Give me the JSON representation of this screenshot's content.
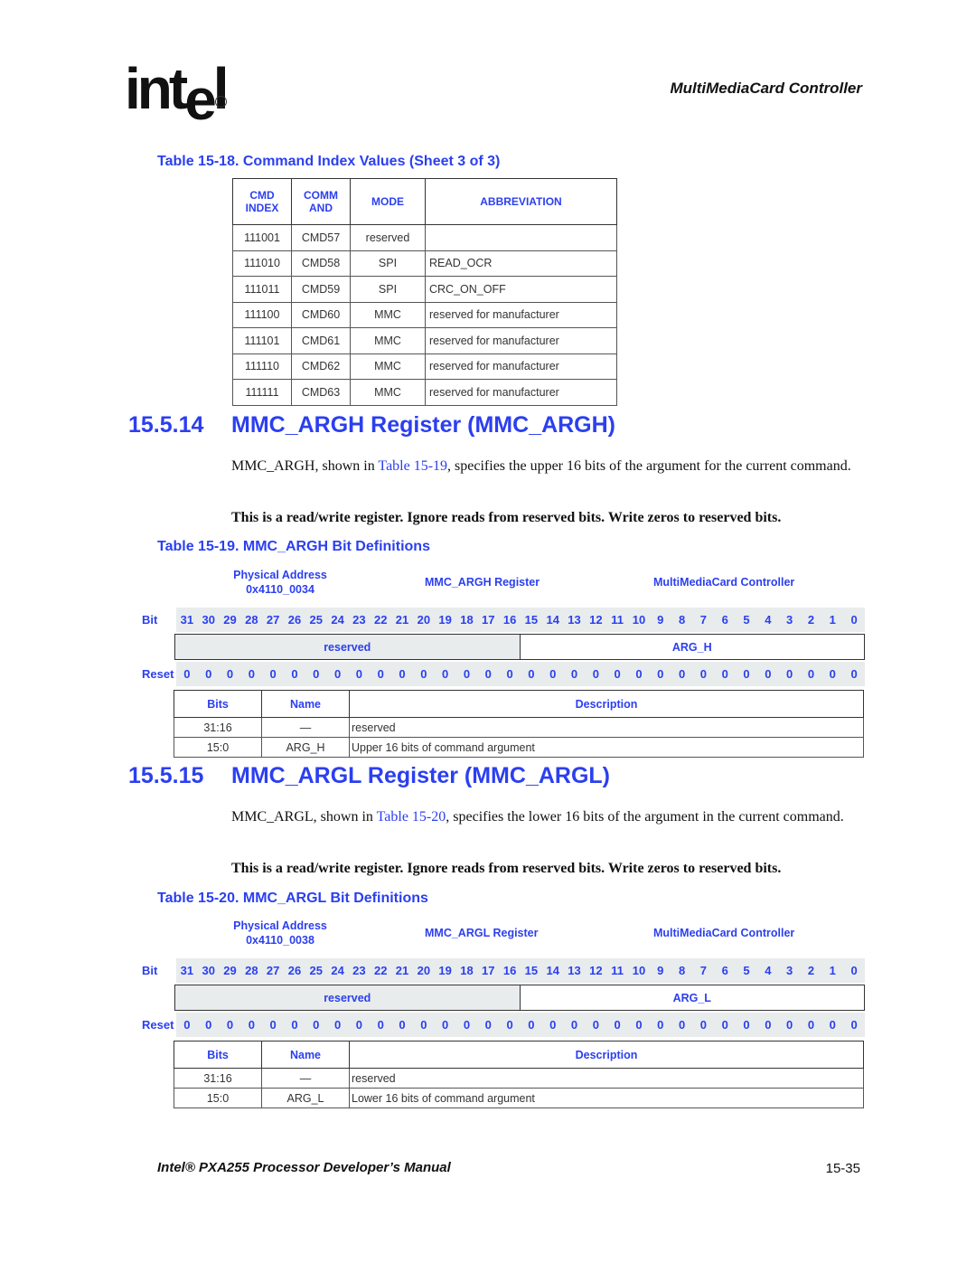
{
  "header": {
    "logo": "intel",
    "chapter": "MultiMediaCard Controller"
  },
  "table18": {
    "caption": "Table 15-18. Command Index Values (Sheet 3 of 3)",
    "headers": [
      "CMD INDEX",
      "COMM AND",
      "MODE",
      "ABBREVIATION"
    ],
    "rows": [
      [
        "111001",
        "CMD57",
        "reserved",
        ""
      ],
      [
        "111010",
        "CMD58",
        "SPI",
        "READ_OCR"
      ],
      [
        "111011",
        "CMD59",
        "SPI",
        "CRC_ON_OFF"
      ],
      [
        "111100",
        "CMD60",
        "MMC",
        "reserved for manufacturer"
      ],
      [
        "111101",
        "CMD61",
        "MMC",
        "reserved for manufacturer"
      ],
      [
        "111110",
        "CMD62",
        "MMC",
        "reserved for manufacturer"
      ],
      [
        "111111",
        "CMD63",
        "MMC",
        "reserved for manufacturer"
      ]
    ]
  },
  "section14": {
    "number": "15.5.14",
    "title": "MMC_ARGH Register (MMC_ARGH)",
    "para1_pre": "MMC_ARGH, shown in ",
    "para1_link": "Table 15-19",
    "para1_post": ", specifies the upper 16 bits of the argument for the current command.",
    "para2": "This is a read/write register. Ignore reads from reserved bits. Write zeros to reserved bits.",
    "table_caption": "Table 15-19. MMC_ARGH Bit Definitions",
    "register": {
      "address_label": "Physical Address",
      "address": "0x4110_0034",
      "name": "MMC_ARGH Register",
      "unit": "MultiMediaCard Controller",
      "bit_label": "Bit",
      "reset_label": "Reset",
      "bits": [
        "31",
        "30",
        "29",
        "28",
        "27",
        "26",
        "25",
        "24",
        "23",
        "22",
        "21",
        "20",
        "19",
        "18",
        "17",
        "16",
        "15",
        "14",
        "13",
        "12",
        "11",
        "10",
        "9",
        "8",
        "7",
        "6",
        "5",
        "4",
        "3",
        "2",
        "1",
        "0"
      ],
      "resets": [
        "0",
        "0",
        "0",
        "0",
        "0",
        "0",
        "0",
        "0",
        "0",
        "0",
        "0",
        "0",
        "0",
        "0",
        "0",
        "0",
        "0",
        "0",
        "0",
        "0",
        "0",
        "0",
        "0",
        "0",
        "0",
        "0",
        "0",
        "0",
        "0",
        "0",
        "0",
        "0"
      ],
      "fields": [
        "reserved",
        "ARG_H"
      ]
    },
    "defs": {
      "headers": [
        "Bits",
        "Name",
        "Description"
      ],
      "rows": [
        [
          "31:16",
          "—",
          "reserved"
        ],
        [
          "15:0",
          "ARG_H",
          "Upper 16 bits of command argument"
        ]
      ]
    }
  },
  "section15": {
    "number": "15.5.15",
    "title": "MMC_ARGL Register (MMC_ARGL)",
    "para1_pre": "MMC_ARGL, shown in ",
    "para1_link": "Table 15-20",
    "para1_post": ", specifies the lower 16 bits of the argument in the current command.",
    "para2": "This is a read/write register. Ignore reads from reserved bits. Write zeros to reserved bits.",
    "table_caption": "Table 15-20. MMC_ARGL Bit Definitions",
    "register": {
      "address_label": "Physical Address",
      "address": "0x4110_0038",
      "name": "MMC_ARGL Register",
      "unit": "MultiMediaCard Controller",
      "bit_label": "Bit",
      "reset_label": "Reset",
      "bits": [
        "31",
        "30",
        "29",
        "28",
        "27",
        "26",
        "25",
        "24",
        "23",
        "22",
        "21",
        "20",
        "19",
        "18",
        "17",
        "16",
        "15",
        "14",
        "13",
        "12",
        "11",
        "10",
        "9",
        "8",
        "7",
        "6",
        "5",
        "4",
        "3",
        "2",
        "1",
        "0"
      ],
      "resets": [
        "0",
        "0",
        "0",
        "0",
        "0",
        "0",
        "0",
        "0",
        "0",
        "0",
        "0",
        "0",
        "0",
        "0",
        "0",
        "0",
        "0",
        "0",
        "0",
        "0",
        "0",
        "0",
        "0",
        "0",
        "0",
        "0",
        "0",
        "0",
        "0",
        "0",
        "0",
        "0"
      ],
      "fields": [
        "reserved",
        "ARG_L"
      ]
    },
    "defs": {
      "headers": [
        "Bits",
        "Name",
        "Description"
      ],
      "rows": [
        [
          "31:16",
          "—",
          "reserved"
        ],
        [
          "15:0",
          "ARG_L",
          "Lower 16 bits of command argument"
        ]
      ]
    }
  },
  "footer": {
    "manual": "Intel® PXA255 Processor Developer’s Manual",
    "page": "15-35"
  }
}
